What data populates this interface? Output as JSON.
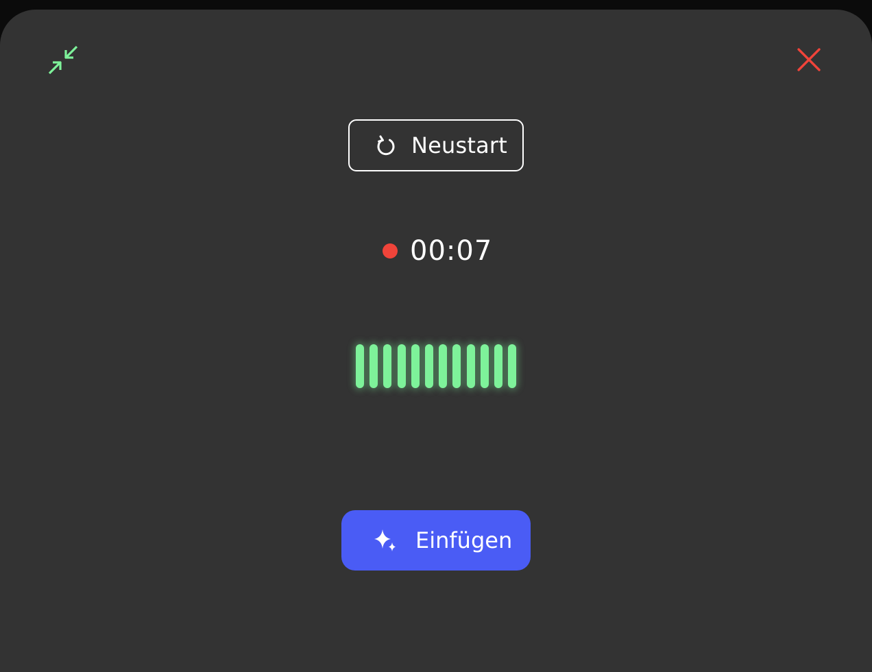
{
  "window": {
    "minimize_icon": "compress-arrows-icon",
    "close_icon": "close-x-icon",
    "minimize_color": "#7ef29a",
    "close_color": "#f0443a"
  },
  "restart_button": {
    "label": "Neustart",
    "icon": "restart-circular-arrow-icon"
  },
  "recording": {
    "time": "00:07",
    "indicator_color": "#f0443a"
  },
  "audio_level": {
    "bar_count": 12,
    "levels": [
      1,
      1,
      1,
      1,
      1,
      1,
      1,
      1,
      1,
      1,
      1,
      1
    ],
    "color": "#7ef29a"
  },
  "insert_button": {
    "label": "Einfügen",
    "icon": "sparkle-icon",
    "color": "#4a5cf5"
  }
}
